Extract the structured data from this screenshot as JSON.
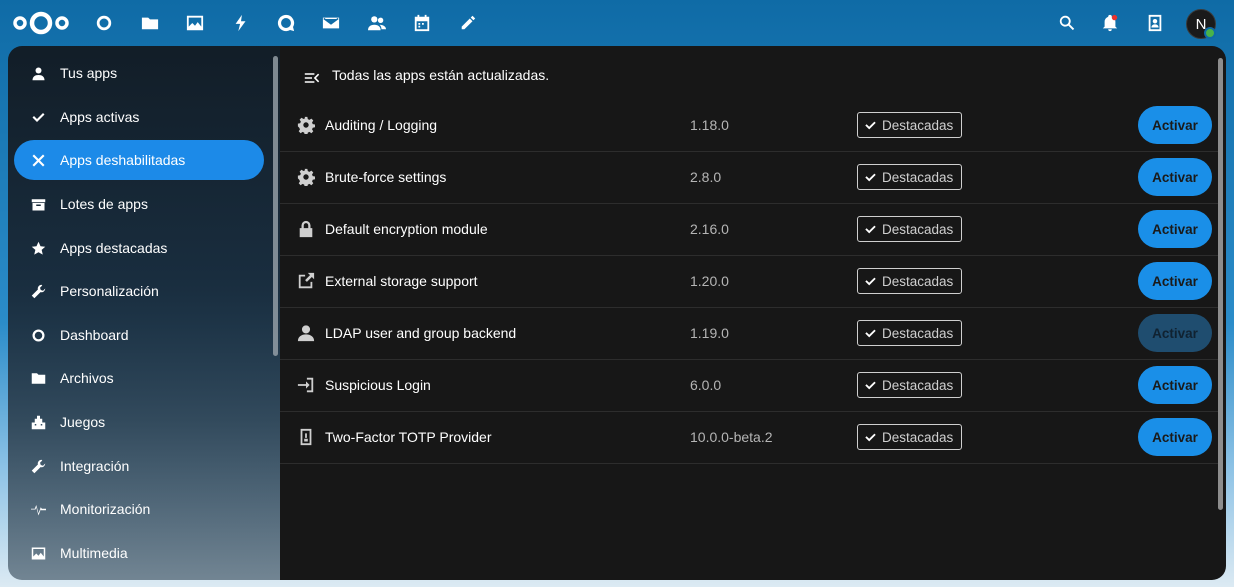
{
  "header": {
    "nav_icons": [
      "dashboard-icon",
      "files-icon",
      "photos-icon",
      "activity-icon",
      "talk-icon",
      "mail-icon",
      "contacts-icon",
      "calendar-icon",
      "notes-icon"
    ],
    "right_icons": [
      "search-icon",
      "notifications-icon",
      "contacts-menu-icon"
    ],
    "avatar_initial": "N"
  },
  "sidebar": {
    "items": [
      {
        "label": "Tus apps",
        "icon": "user-icon"
      },
      {
        "label": "Apps activas",
        "icon": "check-icon"
      },
      {
        "label": "Apps deshabilitadas",
        "icon": "close-icon",
        "active": true
      },
      {
        "label": "Lotes de apps",
        "icon": "archive-icon"
      },
      {
        "label": "Apps destacadas",
        "icon": "star-icon"
      },
      {
        "label": "Personalización",
        "icon": "wrench-icon"
      },
      {
        "label": "Dashboard",
        "icon": "circle-icon"
      },
      {
        "label": "Archivos",
        "icon": "folder-icon"
      },
      {
        "label": "Juegos",
        "icon": "games-icon"
      },
      {
        "label": "Integración",
        "icon": "wrench-icon"
      },
      {
        "label": "Monitorización",
        "icon": "pulse-icon"
      },
      {
        "label": "Multimedia",
        "icon": "image-icon"
      }
    ]
  },
  "main": {
    "status": "Todas las apps están actualizadas.",
    "badge_label": "Destacadas",
    "button_label": "Activar",
    "apps": [
      {
        "name": "Auditing / Logging",
        "version": "1.18.0",
        "icon": "gear-icon"
      },
      {
        "name": "Brute-force settings",
        "version": "2.8.0",
        "icon": "gear-icon"
      },
      {
        "name": "Default encryption module",
        "version": "2.16.0",
        "icon": "lock-icon"
      },
      {
        "name": "External storage support",
        "version": "1.20.0",
        "icon": "external-link-icon"
      },
      {
        "name": "LDAP user and group backend",
        "version": "1.19.0",
        "icon": "user-icon"
      },
      {
        "name": "Suspicious Login",
        "version": "6.0.0",
        "icon": "login-icon"
      },
      {
        "name": "Two-Factor TOTP Provider",
        "version": "10.0.0-beta.2",
        "icon": "totp-icon"
      }
    ]
  },
  "colors": {
    "accent": "#1a8fe8",
    "main_bg": "#171717"
  }
}
